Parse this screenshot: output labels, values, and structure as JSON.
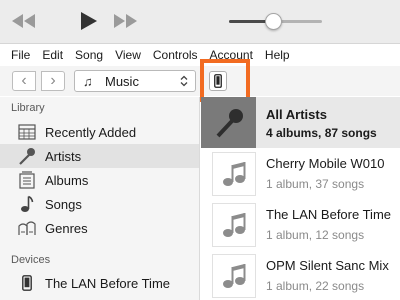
{
  "player": {
    "controls": [
      {
        "name": "rewind-icon",
        "glyph": "◀◀"
      },
      {
        "name": "play-icon",
        "glyph": "▶"
      },
      {
        "name": "fast-forward-icon",
        "glyph": "▶▶"
      }
    ],
    "volume_level": 0.47
  },
  "menu": {
    "items": [
      "File",
      "Edit",
      "Song",
      "View",
      "Controls",
      "Account",
      "Help"
    ]
  },
  "toolbar": {
    "back_glyph": "‹",
    "forward_glyph": "›",
    "media_label": "Music",
    "media_icon": "♫",
    "device_icon": "phone-icon",
    "highlight_color": "#f26b21"
  },
  "sidebar": {
    "library_header": "Library",
    "library_items": [
      {
        "label": "Recently Added",
        "icon": "recently-added-icon",
        "selected": false
      },
      {
        "label": "Artists",
        "icon": "microphone-icon",
        "selected": true
      },
      {
        "label": "Albums",
        "icon": "albums-icon",
        "selected": false
      },
      {
        "label": "Songs",
        "icon": "note-icon",
        "selected": false
      },
      {
        "label": "Genres",
        "icon": "genres-icon",
        "selected": false
      }
    ],
    "devices_header": "Devices",
    "device_items": [
      {
        "label": "The LAN Before Time",
        "icon": "phone-icon"
      }
    ]
  },
  "artists": {
    "rows": [
      {
        "name": "All Artists",
        "sub": "4 albums, 87 songs",
        "selected": true
      },
      {
        "name": "Cherry Mobile W010",
        "sub": "1 album, 37 songs",
        "selected": false
      },
      {
        "name": "The LAN Before Time",
        "sub": "1 album, 12 songs",
        "selected": false
      },
      {
        "name": "OPM Silent Sanc Mix",
        "sub": "1 album, 22 songs",
        "selected": false
      }
    ]
  }
}
